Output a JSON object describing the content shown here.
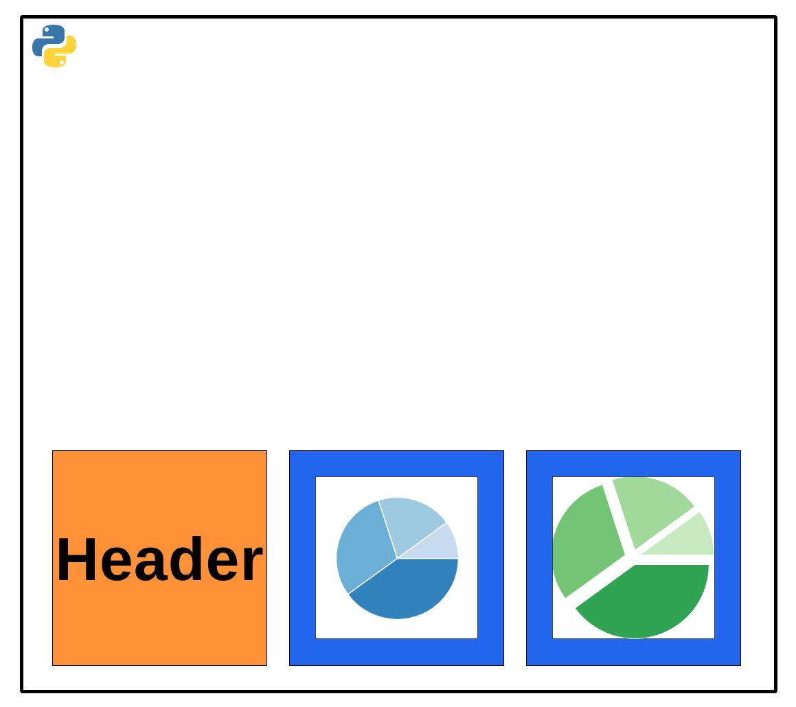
{
  "header_tile": {
    "label": "Header",
    "color": "#FF9239"
  },
  "tile_frame_color": "#2266EE",
  "logo": {
    "icon": "python-logo-icon",
    "colors": [
      "#3776AB",
      "#FFD43B"
    ]
  },
  "chart_data": [
    {
      "type": "pie",
      "title": "",
      "values": [
        40,
        30,
        20,
        10
      ],
      "colors": [
        "#3182BD",
        "#6BAED6",
        "#9ECAE1",
        "#C6DBEF"
      ],
      "explode": [
        0,
        0,
        0,
        0
      ]
    },
    {
      "type": "pie",
      "title": "",
      "values": [
        40,
        30,
        20,
        10
      ],
      "colors": [
        "#31A354",
        "#74C476",
        "#A1D99B",
        "#C7E9C0"
      ],
      "explode": [
        0.05,
        0.05,
        0.05,
        0.05
      ]
    }
  ]
}
